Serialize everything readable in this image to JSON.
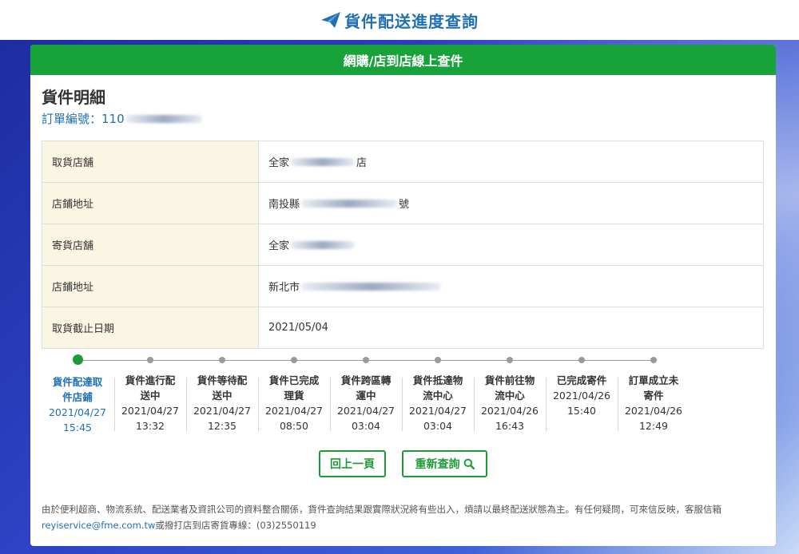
{
  "header": {
    "title": "貨件配送進度查詢",
    "icon": "paper-plane-icon"
  },
  "card": {
    "bar_title": "網購/店到店線上查件"
  },
  "details": {
    "title": "貨件明細",
    "order_label": "訂單編號：",
    "order_value": "110",
    "rows": [
      {
        "label": "取貨店舖",
        "prefix": "全家",
        "suffix": "店"
      },
      {
        "label": "店鋪地址",
        "prefix": "南投縣",
        "suffix": "號"
      },
      {
        "label": "寄貨店舖",
        "prefix": "全家",
        "suffix": ""
      },
      {
        "label": "店鋪地址",
        "prefix": "新北市",
        "suffix": ""
      },
      {
        "label": "取貨截止日期",
        "prefix": "2021/05/04",
        "suffix": ""
      }
    ]
  },
  "timeline": {
    "steps": [
      {
        "name": "貨件配達取件店鋪",
        "date": "2021/04/27",
        "time": "15:45",
        "active": true
      },
      {
        "name": "貨件進行配送中",
        "date": "2021/04/27",
        "time": "13:32"
      },
      {
        "name": "貨件等待配送中",
        "date": "2021/04/27",
        "time": "12:35"
      },
      {
        "name": "貨件已完成理貨",
        "date": "2021/04/27",
        "time": "08:50"
      },
      {
        "name": "貨件跨區轉運中",
        "date": "2021/04/27",
        "time": "03:04"
      },
      {
        "name": "貨件抵達物流中心",
        "date": "2021/04/27",
        "time": "03:04"
      },
      {
        "name": "貨件前往物流中心",
        "date": "2021/04/26",
        "time": "16:43"
      },
      {
        "name": "已完成寄件",
        "date": "2021/04/26",
        "time": "15:40"
      },
      {
        "name": "訂單成立未寄件",
        "date": "2021/04/26",
        "time": "12:49"
      }
    ]
  },
  "buttons": {
    "back": "回上一頁",
    "requery": "重新查詢",
    "requery_icon": "search-icon"
  },
  "footer": {
    "text_before": "由於便利超商、物流系統、配送業者及資訊公司的資料整合關係，貨件查詢結果跟實際狀況將有些出入，煩請以最終配送狀態為主。有任何疑問，可來信反映，客服信箱",
    "email": "reyiservice@fme.com.tw",
    "text_after": "或撥打店到店寄貨專線：(03)2550119"
  },
  "colors": {
    "brand_blue": "#1f6fb5",
    "brand_green": "#18a33a",
    "label_bg": "#fbf6e3"
  }
}
